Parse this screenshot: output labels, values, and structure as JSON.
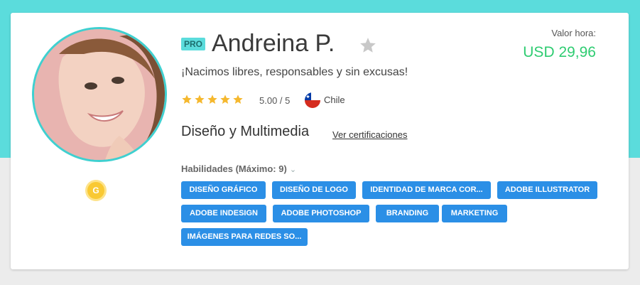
{
  "profile": {
    "pro_badge": "PRO",
    "name": "Andreina P.",
    "tagline": "¡Nacimos libres, responsables y sin excusas!",
    "rating_text": "5.00 / 5",
    "rating_value": 5,
    "rating_max": 5,
    "country": "Chile",
    "category": "Diseño y Multimedia",
    "certifications_link": "Ver certificaciones",
    "level_badge": "G"
  },
  "rate": {
    "label": "Valor hora:",
    "value": "USD 29,96"
  },
  "skills": {
    "title": "Habilidades (Máximo: 9)",
    "tags": [
      "DISEÑO GRÁFICO",
      "DISEÑO DE LOGO",
      "IDENTIDAD DE MARCA COR...",
      "ADOBE ILLUSTRATOR",
      "ADOBE INDESIGN",
      "ADOBE PHOTOSHOP",
      "BRANDING",
      "MARKETING",
      "IMÁGENES PARA REDES SO..."
    ]
  },
  "colors": {
    "accent_teal": "#5bdcdc",
    "tag_blue": "#2b8fe6",
    "price_green": "#2ecc71",
    "star_gold": "#f5b82e"
  },
  "icons": {
    "favorite": "star-outline-icon",
    "rating": "star-icon",
    "flag": "chile-flag-icon",
    "dropdown": "chevron-down-icon",
    "level": "gold-medal-icon"
  }
}
